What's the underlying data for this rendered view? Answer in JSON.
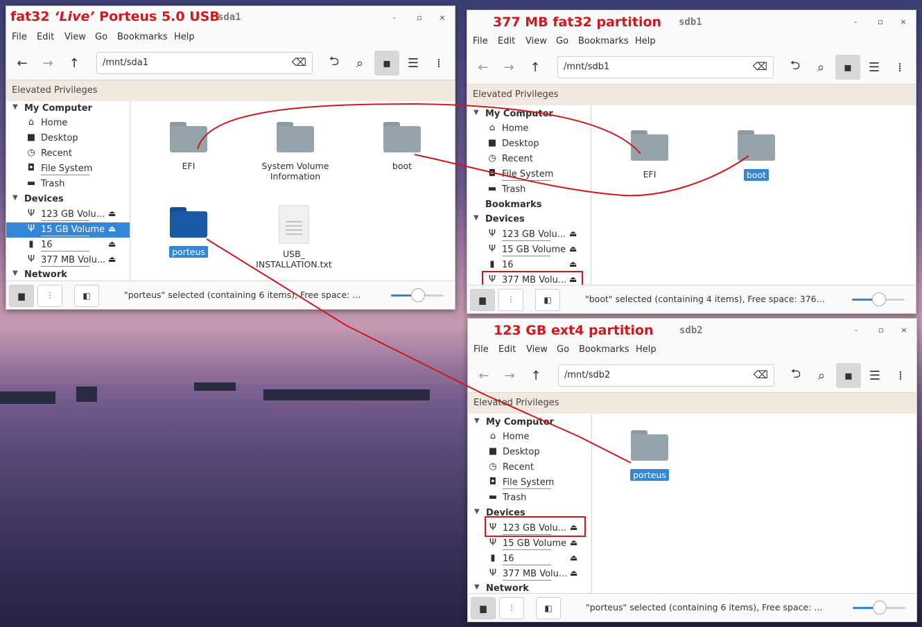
{
  "annotations": {
    "red_color": "#d4151b",
    "win1": {
      "title_a": "fat32 ",
      "title_live": "‘Live’",
      "title_b": " Porteus 5.0 USB",
      "device": "sda1"
    },
    "win2": {
      "title": "377 MB fat32 partition",
      "device": "sdb1"
    },
    "win3": {
      "title": "123 GB ext4 partition",
      "device": "sdb2"
    }
  },
  "common": {
    "menu": [
      "File",
      "Edit",
      "View",
      "Go",
      "Bookmarks",
      "Help"
    ],
    "window_controls": {
      "minimize": "-",
      "maximize": "▫",
      "close": "×"
    },
    "elevated": "Elevated Privileges",
    "sidebar": {
      "my_computer": "My Computer",
      "home": "Home",
      "desktop": "Desktop",
      "recent": "Recent",
      "file_system": "File System",
      "trash": "Trash",
      "bookmarks": "Bookmarks",
      "devices": "Devices",
      "dev_123": "123 GB Volu...",
      "dev_15": "15 GB Volume",
      "dev_16": "16",
      "dev_377": "377 MB Volu...",
      "network": "Network"
    }
  },
  "win1": {
    "path": "/mnt/sda1",
    "files": {
      "efi": "EFI",
      "svi": "System Volume\nInformation",
      "boot": "boot",
      "porteus": "porteus",
      "usb": "USB_\nINSTALLATION.txt"
    },
    "status": "\"porteus\" selected (containing 6 items), Free space: ...",
    "zoom_fraction": 0.5
  },
  "win2": {
    "path": "/mnt/sdb1",
    "files": {
      "efi": "EFI",
      "boot": "boot"
    },
    "status": "\"boot\" selected (containing 4 items), Free space: 376...",
    "zoom_fraction": 0.5
  },
  "win3": {
    "path": "/mnt/sdb2",
    "files": {
      "porteus": "porteus"
    },
    "status": "\"porteus\" selected (containing 6 items), Free space: ...",
    "zoom_fraction": 0.5
  }
}
